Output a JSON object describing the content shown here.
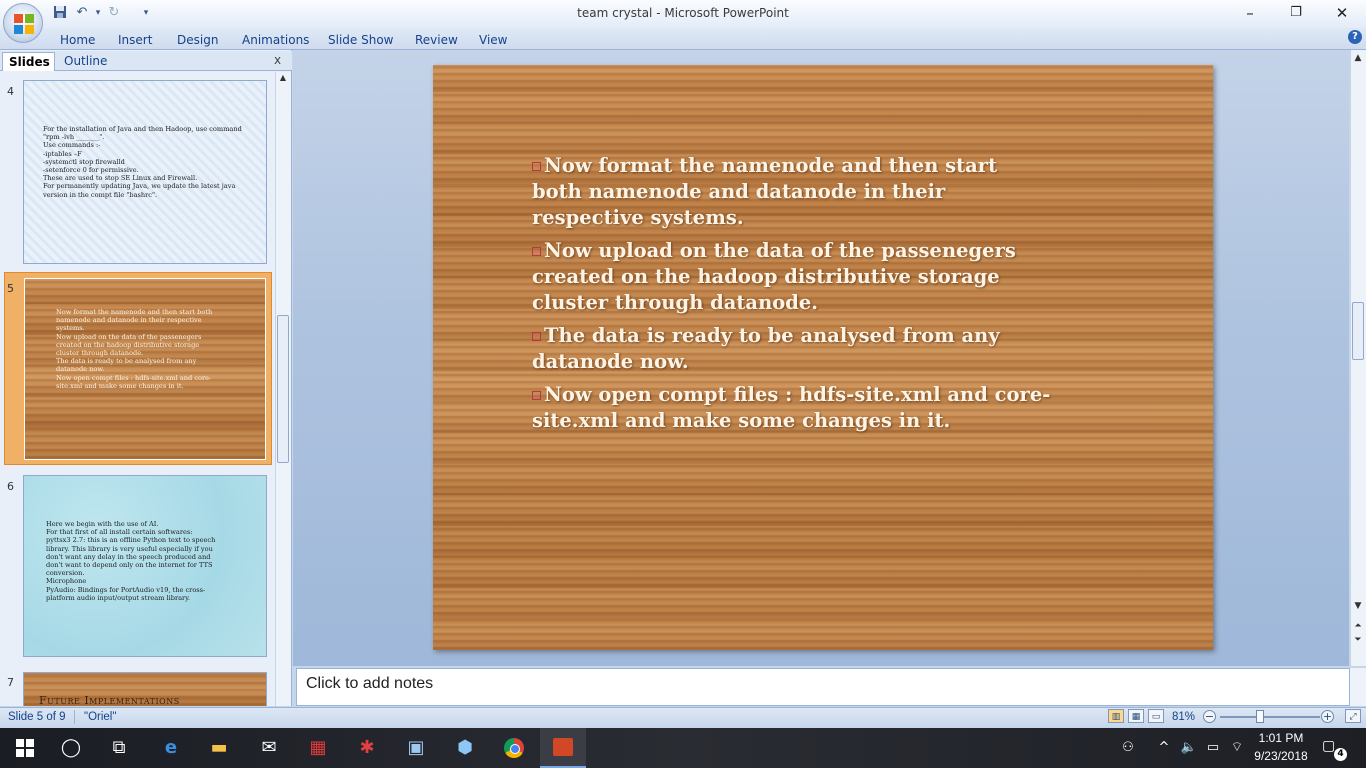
{
  "window": {
    "title": "team crystal - Microsoft PowerPoint"
  },
  "ribbon": {
    "tabs": [
      "Home",
      "Insert",
      "Design",
      "Animations",
      "Slide Show",
      "Review",
      "View"
    ]
  },
  "panel": {
    "tabs": [
      "Slides",
      "Outline"
    ],
    "close": "x"
  },
  "thumbnails": [
    {
      "number": "4",
      "lines": [
        "For the installation of Java and then Hadoop, use command \"rpm -ivh _______\".",
        "Use commands :-",
        "-iptables –F",
        "-systemctl stop firewalld",
        "-setenforce 0 for permissive.",
        "These are used to stop SE Linux and Firewall.",
        "For permanently updating Java, we update the latest java version in the compt file \"bashrc\"."
      ]
    },
    {
      "number": "5",
      "lines": [
        "Now format the namenode and then start both namenode and datanode in their respective systems.",
        "Now upload on the data of the passenegers created  on the hadoop distributive storage cluster through datanode.",
        "The data is ready to be analysed from any datanode now.",
        "Now open compt files : hdfs-site.xml and core-site.xml  and make some changes in it."
      ]
    },
    {
      "number": "6",
      "lines": [
        "Here we begin with the use of AI.",
        "For that first of all install certain softwares:",
        "pyttsx3 2.7: this is an offline Python text to speech library. This library is very useful especially if you don't want any delay in the speech produced and don't want to depend only on the internet for TTS conversion.",
        "Microphone",
        "PyAudio: Bindings for PortAudio v19, the cross-platform audio input/output stream library."
      ]
    },
    {
      "number": "7",
      "title": "Future Implementations"
    }
  ],
  "slide": {
    "bullets": [
      "Now format the namenode and then start both namenode and datanode in their respective systems.",
      "Now upload on the data of the passenegers created  on the hadoop distributive storage cluster through datanode.",
      "The data is ready to be analysed from any datanode now.",
      "Now open compt files : hdfs-site.xml and core-site.xml  and make some changes in it."
    ]
  },
  "notes": {
    "placeholder": "Click to add notes"
  },
  "status": {
    "slide_info": "Slide 5 of 9",
    "theme": "\"Oriel\"",
    "zoom": "81%"
  },
  "taskbar": {
    "time": "1:01 PM",
    "date": "9/23/2018",
    "notifications": "4"
  },
  "colors": {
    "ribbon_text": "#15428b",
    "slide_text": "#fdf4e6",
    "bullet_square": "#c0314c",
    "selected_thumb": "#f0b065"
  }
}
